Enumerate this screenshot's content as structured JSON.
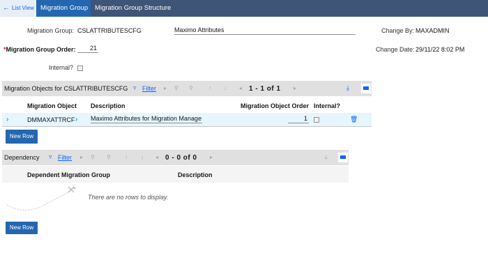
{
  "tabs": {
    "list_view": "List View",
    "migration_group": "Migration Group",
    "migration_group_structure": "Migration Group Structure"
  },
  "header": {
    "migration_group_label": "Migration Group:",
    "migration_group_value": "CSLATTRIBUTESCFG",
    "description_value": "Maximo Attributes",
    "change_by_label": "Change By:",
    "change_by_value": "MAXADMIN",
    "order_required_mark": "*",
    "order_label": "Migration Group Order:",
    "order_value": "21",
    "change_date_label": "Change Date:",
    "change_date_value": "29/11/22 8:02 PM",
    "internal_label": "Internal?"
  },
  "objects_table": {
    "title": "Migration Objects for CSLATTRIBUTESCFG",
    "filter_label": "Filter",
    "pager": "1 - 1 of 1",
    "columns": [
      "Migration Object",
      "Description",
      "Migration Object Order",
      "Internal?"
    ],
    "rows": [
      {
        "object": "DMMAXATTRCF",
        "description": "Maximo Attributes for Migration Manage",
        "order": "1"
      }
    ],
    "new_row_label": "New Row"
  },
  "dependency_table": {
    "title": "Dependency",
    "filter_label": "Filter",
    "pager": "0 - 0 of 0",
    "columns": [
      "Dependent Migration Group",
      "Description"
    ],
    "empty_message": "There are no rows to display.",
    "new_row_label": "New Row"
  },
  "colors": {
    "tabbar": "#3e5577",
    "active_tab": "#2467b0",
    "accent": "#0f62fe",
    "section_bar": "#e0e0e0",
    "selected_row": "#e5f6ff"
  },
  "icons": {
    "back": "arrow-left-icon",
    "filter": "filter-icon",
    "download": "download-icon",
    "maximize": "maximize-icon",
    "row_expand": "chevron-right-icon",
    "delete": "trash-icon",
    "empty_illustration": "empty-state-illustration"
  }
}
